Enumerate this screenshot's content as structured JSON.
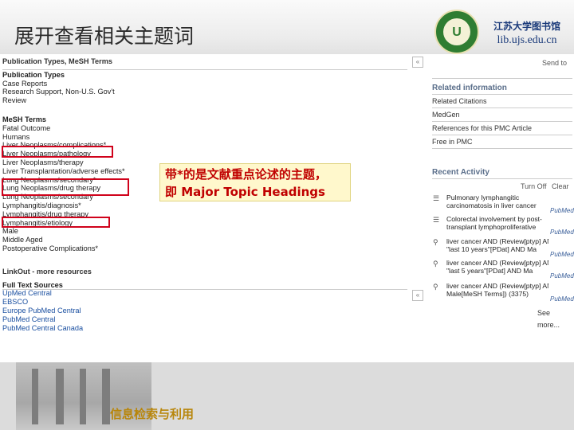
{
  "slide": {
    "title": "展开查看相关主题词",
    "logo_cn": "江苏大学图书馆",
    "logo_url": "lib.ujs.edu.cn",
    "logo_emblem": "U",
    "footer_text": "信息检索与利用",
    "callout_line1": "带*的是文献重点论述的主题，",
    "callout_line2": "即 Major Topic Headings"
  },
  "colors": {
    "highlight_border": "#d0021b",
    "callout_text": "#c00000",
    "footer_text": "#b8860b"
  },
  "left": {
    "section_title": "Publication Types, MeSH Terms",
    "pubtypes_title": "Publication Types",
    "pubtypes": [
      "Case Reports",
      "Research Support, Non-U.S. Gov't",
      "Review"
    ],
    "mesh_title": "MeSH Terms",
    "mesh": [
      "Fatal Outcome",
      "Humans",
      "Liver Neoplasms/complications*",
      "Liver Neoplasms/pathology",
      "Liver Neoplasms/therapy",
      "Liver Transplantation/adverse effects*",
      "Lung Neoplasms/secondary*",
      "Lung Neoplasms/drug therapy",
      "Lung Neoplasms/secondary",
      "Lymphangitis/diagnosis*",
      "Lymphangitis/drug therapy",
      "Lymphangitis/etiology",
      "Male",
      "Middle Aged",
      "Postoperative Complications*"
    ],
    "linkout_title": "LinkOut - more resources",
    "fulltext_title": "Full Text Sources",
    "fulltext": [
      "UpMed Central",
      "EBSCO",
      "Europe PubMed Central",
      "PubMed Central",
      "PubMed Central Canada"
    ],
    "collapse_symbol": "«"
  },
  "right": {
    "top_link": "Send to",
    "related_title": "Related information",
    "related": [
      "Related Citations",
      "MedGen",
      "References for this PMC Article",
      "Free in PMC"
    ],
    "activity_title": "Recent Activity",
    "turn_off": "Turn Off",
    "clear": "Clear",
    "activity": [
      {
        "icon": "document-icon",
        "glyph": "☰",
        "line1": "Pulmonary lymphangitic",
        "line2": "carcinomatosis in liver cancer",
        "source": "PubMed"
      },
      {
        "icon": "document-icon",
        "glyph": "☰",
        "line1": "Colorectal involvement by post-",
        "line2": "transplant lymphoproliferative",
        "source": "PubMed"
      },
      {
        "icon": "search-icon",
        "glyph": "⚲",
        "line1": "liver cancer AND (Review[ptyp] AND",
        "line2": "\"last 10 years\"[PDat] AND Ma",
        "source": "PubMed"
      },
      {
        "icon": "search-icon",
        "glyph": "⚲",
        "line1": "liver cancer AND (Review[ptyp] AND",
        "line2": "\"last 5 years\"[PDat] AND Ma",
        "source": "PubMed"
      },
      {
        "icon": "search-icon",
        "glyph": "⚲",
        "line1": "liver cancer AND (Review[ptyp] AND",
        "line2": "Male[MeSH Terms]) (3375)",
        "source": "PubMed"
      }
    ],
    "see_more": "See more..."
  }
}
